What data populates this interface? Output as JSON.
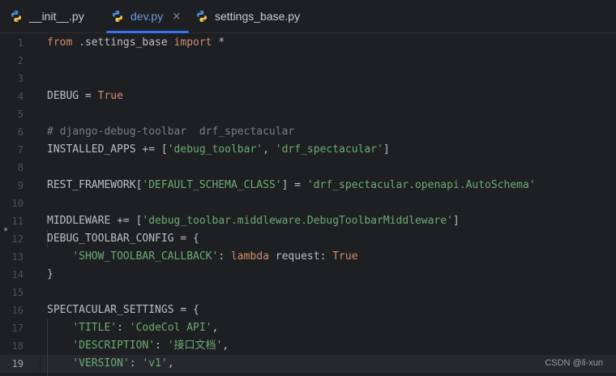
{
  "tabs": [
    {
      "label": "__init__.py",
      "active": false
    },
    {
      "label": "dev.py",
      "active": true
    },
    {
      "label": "settings_base.py",
      "active": false
    }
  ],
  "tab_close_glyph": "×",
  "editor": {
    "current_line": 19,
    "lines": [
      {
        "n": "1",
        "t": [
          [
            "kw",
            "from"
          ],
          [
            "p",
            " .settings_base "
          ],
          [
            "kw",
            "import"
          ],
          [
            "p",
            " *"
          ]
        ]
      },
      {
        "n": "2",
        "t": []
      },
      {
        "n": "3",
        "t": []
      },
      {
        "n": "4",
        "t": [
          [
            "p",
            "DEBUG = "
          ],
          [
            "kw",
            "True"
          ]
        ]
      },
      {
        "n": "5",
        "t": []
      },
      {
        "n": "6",
        "t": [
          [
            "cm",
            "# django-debug-toolbar  drf_spectacular"
          ]
        ]
      },
      {
        "n": "7",
        "t": [
          [
            "p",
            "INSTALLED_APPS += ["
          ],
          [
            "str",
            "'debug_toolbar'"
          ],
          [
            "p",
            ", "
          ],
          [
            "str",
            "'drf_spectacular'"
          ],
          [
            "p",
            "]"
          ]
        ]
      },
      {
        "n": "8",
        "t": []
      },
      {
        "n": "9",
        "t": [
          [
            "p",
            "REST_FRAMEWORK["
          ],
          [
            "str",
            "'DEFAULT_SCHEMA_CLASS'"
          ],
          [
            "p",
            "] = "
          ],
          [
            "str",
            "'drf_spectacular.openapi.AutoSchema'"
          ]
        ]
      },
      {
        "n": "10",
        "t": []
      },
      {
        "n": "11",
        "t": [
          [
            "p",
            "MIDDLEWARE += ["
          ],
          [
            "str",
            "'debug_toolbar.middleware.DebugToolbarMiddleware'"
          ],
          [
            "p",
            "]"
          ]
        ]
      },
      {
        "n": "12",
        "t": [
          [
            "p",
            "DEBUG_TOOLBAR_CONFIG = {"
          ]
        ]
      },
      {
        "n": "13",
        "t": [
          [
            "p",
            "    "
          ],
          [
            "str",
            "'SHOW_TOOLBAR_CALLBACK'"
          ],
          [
            "p",
            ": "
          ],
          [
            "kw",
            "lambda"
          ],
          [
            "p",
            " request: "
          ],
          [
            "kw",
            "True"
          ]
        ]
      },
      {
        "n": "14",
        "t": [
          [
            "p",
            "}"
          ]
        ]
      },
      {
        "n": "15",
        "t": []
      },
      {
        "n": "16",
        "t": [
          [
            "p",
            "SPECTACULAR_SETTINGS = {"
          ]
        ]
      },
      {
        "n": "17",
        "t": [
          [
            "p",
            "    "
          ],
          [
            "str",
            "'TITLE'"
          ],
          [
            "p",
            ": "
          ],
          [
            "str",
            "'CodeCol API'"
          ],
          [
            "p",
            ","
          ]
        ]
      },
      {
        "n": "18",
        "t": [
          [
            "p",
            "    "
          ],
          [
            "str",
            "'DESCRIPTION'"
          ],
          [
            "p",
            ": "
          ],
          [
            "str",
            "'接口文档'"
          ],
          [
            "p",
            ","
          ]
        ]
      },
      {
        "n": "19",
        "t": [
          [
            "p",
            "    "
          ],
          [
            "str",
            "'VERSION'"
          ],
          [
            "p",
            ": "
          ],
          [
            "str",
            "'v1'"
          ],
          [
            "p",
            ","
          ]
        ]
      }
    ]
  },
  "watermark": "CSDN @li-xun",
  "colors": {
    "background": "#1e1f22",
    "keyword": "#cf8e6d",
    "string": "#6aab73",
    "comment": "#7a7e85",
    "plain": "#bcbec4",
    "accent": "#3574f0"
  },
  "icons": {
    "tab_file_icon": "python-file-icon",
    "tab_close_icon": "close-icon"
  }
}
